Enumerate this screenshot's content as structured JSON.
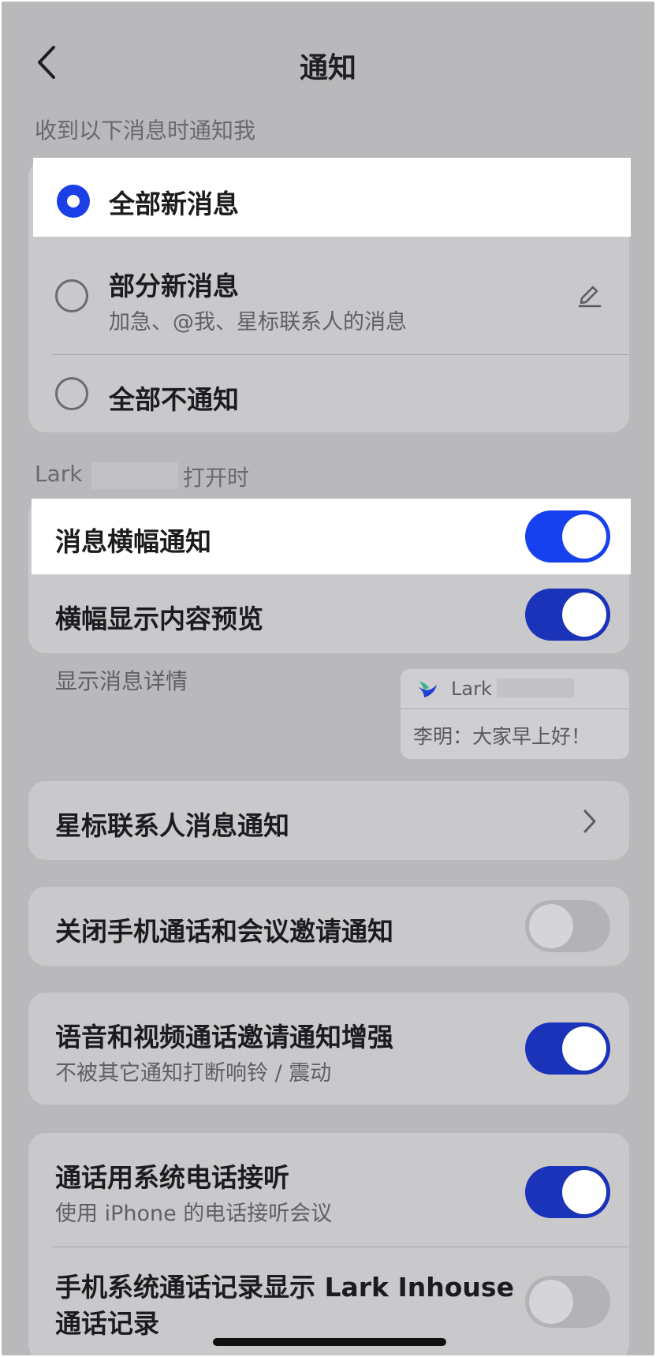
{
  "header": {
    "title": "通知",
    "back_icon": "chevron-left-icon"
  },
  "notify_section": {
    "label": "收到以下消息时通知我",
    "options": [
      {
        "label": "全部新消息",
        "selected": true
      },
      {
        "label": "部分新消息",
        "sub": "加急、@我、星标联系人的消息",
        "selected": false,
        "edit_icon": "pencil-icon"
      },
      {
        "label": "全部不通知",
        "selected": false
      }
    ]
  },
  "open_section": {
    "label_prefix": "Lark",
    "label_suffix": "打开时",
    "rows": [
      {
        "label": "消息横幅通知",
        "on": true
      },
      {
        "label": "横幅显示内容预览",
        "on": true
      }
    ],
    "detail_label": "显示消息详情",
    "preview": {
      "app_name": "Lark",
      "message": "李明：大家早上好！"
    }
  },
  "starred": {
    "label": "星标联系人消息通知",
    "chevron_icon": "chevron-right-icon"
  },
  "close_call": {
    "label": "关闭手机通话和会议邀请通知",
    "on": false
  },
  "voice_video": {
    "label": "语音和视频通话邀请通知增强",
    "sub": "不被其它通知打断响铃 / 震动",
    "on": true
  },
  "system_call": {
    "rows": [
      {
        "label": "通话用系统电话接听",
        "sub": "使用 iPhone 的电话接听会议",
        "on": true
      },
      {
        "label": "手机系统通话记录显示 Lark Inhouse",
        "label2": "通话记录",
        "on": false
      }
    ]
  },
  "colors": {
    "accent": "#1b3fe6",
    "background": "#b9b9bb",
    "card": "#c9c9cb"
  }
}
